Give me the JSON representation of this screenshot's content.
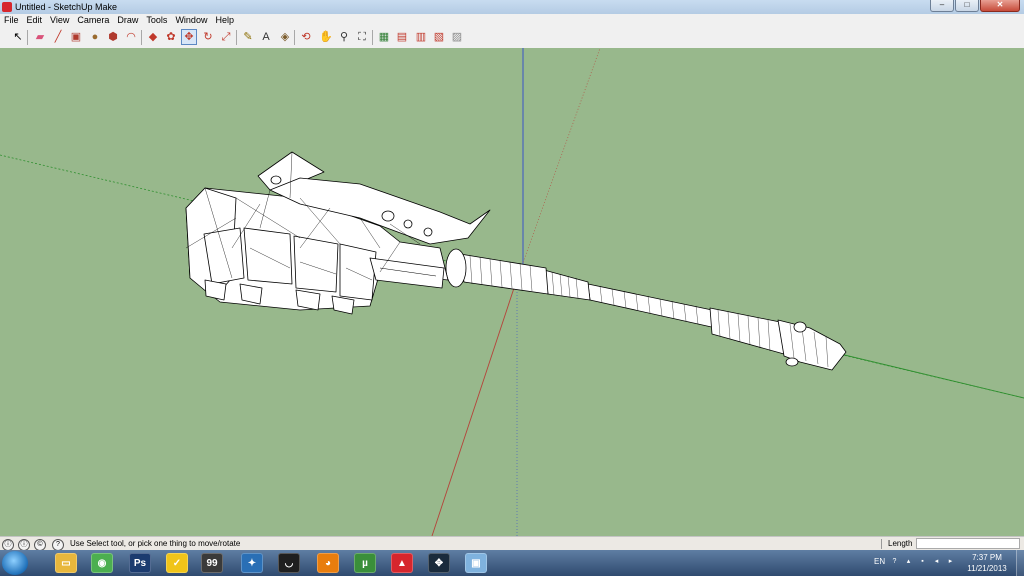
{
  "window": {
    "title": "Untitled - SketchUp Make",
    "minimize": "–",
    "maximize": "□",
    "close": "✕"
  },
  "menu": [
    "File",
    "Edit",
    "View",
    "Camera",
    "Draw",
    "Tools",
    "Window",
    "Help"
  ],
  "toolbar": {
    "tools": [
      {
        "name": "select-tool-icon",
        "glyph": "↖",
        "color": "#000000",
        "active": false
      },
      {
        "name": "eraser-tool-icon",
        "glyph": "▰",
        "color": "#d9537a",
        "active": false
      },
      {
        "name": "line-tool-icon",
        "glyph": "╱",
        "color": "#c0392b",
        "active": false
      },
      {
        "name": "rectangle-tool-icon",
        "glyph": "▣",
        "color": "#b03a2e",
        "active": false
      },
      {
        "name": "circle-tool-icon",
        "glyph": "●",
        "color": "#9a6b2f",
        "active": false
      },
      {
        "name": "polygon-tool-icon",
        "glyph": "⬢",
        "color": "#b03a2e",
        "active": false
      },
      {
        "name": "arc-tool-icon",
        "glyph": "◠",
        "color": "#c0392b",
        "active": false
      },
      {
        "name": "push-pull-tool-icon",
        "glyph": "◆",
        "color": "#c0392b",
        "active": false
      },
      {
        "name": "follow-me-tool-icon",
        "glyph": "✿",
        "color": "#c0392b",
        "active": false
      },
      {
        "name": "move-tool-icon",
        "glyph": "✥",
        "color": "#c0392b",
        "active": true
      },
      {
        "name": "rotate-tool-icon",
        "glyph": "↻",
        "color": "#c0392b",
        "active": false
      },
      {
        "name": "scale-tool-icon",
        "glyph": "⤢",
        "color": "#c0392b",
        "active": false
      },
      {
        "name": "tape-measure-tool-icon",
        "glyph": "✎",
        "color": "#8a6d00",
        "active": false
      },
      {
        "name": "text-tool-icon",
        "glyph": "A",
        "color": "#333333",
        "active": false
      },
      {
        "name": "paint-bucket-tool-icon",
        "glyph": "◈",
        "color": "#7a5a2a",
        "active": false
      },
      {
        "name": "orbit-tool-icon",
        "glyph": "⟲",
        "color": "#c0392b",
        "active": false
      },
      {
        "name": "pan-tool-icon",
        "glyph": "✋",
        "color": "#333333",
        "active": false
      },
      {
        "name": "zoom-tool-icon",
        "glyph": "⚲",
        "color": "#333333",
        "active": false
      },
      {
        "name": "zoom-extents-tool-icon",
        "glyph": "⛶",
        "color": "#333333",
        "active": false
      },
      {
        "name": "geo-location-icon",
        "glyph": "▦",
        "color": "#2e7d32",
        "active": false
      },
      {
        "name": "3d-warehouse-icon",
        "glyph": "▤",
        "color": "#c0392b",
        "active": false
      },
      {
        "name": "share-model-icon",
        "glyph": "▥",
        "color": "#c0392b",
        "active": false
      },
      {
        "name": "extension-warehouse-icon",
        "glyph": "▧",
        "color": "#c0392b",
        "active": false
      },
      {
        "name": "send-to-layout-icon",
        "glyph": "▨",
        "color": "#888888",
        "active": false
      }
    ]
  },
  "colors": {
    "sky_ground": "#98b88c",
    "axis_blue": "#3a53c8",
    "axis_red": "#b5433a",
    "axis_green": "#2f8f2f",
    "model_fill": "#ffffff"
  },
  "status": {
    "icons": [
      "ⓘ",
      "ⓘ",
      "©",
      "?"
    ],
    "hint": "Use Select tool, or pick one thing to move/rotate",
    "measurement_label": "Length",
    "measurement_value": ""
  },
  "taskbar": {
    "apps": [
      {
        "name": "file-explorer-icon",
        "glyph": "▭",
        "color": "#e8b73c"
      },
      {
        "name": "chrome-icon",
        "glyph": "◉",
        "color": "#4caf50"
      },
      {
        "name": "photoshop-icon",
        "glyph": "Ps",
        "color": "#1b3b6f"
      },
      {
        "name": "norton-icon",
        "glyph": "✓",
        "color": "#f0c419"
      },
      {
        "name": "winamp-icon",
        "glyph": "99",
        "color": "#3a3a3a"
      },
      {
        "name": "vector-app-icon",
        "glyph": "✦",
        "color": "#2a6fb5"
      },
      {
        "name": "headphones-app-icon",
        "glyph": "◡",
        "color": "#1f1f1f"
      },
      {
        "name": "blender-icon",
        "glyph": "◕",
        "color": "#e87d0d"
      },
      {
        "name": "utorrent-icon",
        "glyph": "µ",
        "color": "#3a8f3a"
      },
      {
        "name": "sketchup-icon",
        "glyph": "▲",
        "color": "#d6262d"
      },
      {
        "name": "network-app-icon",
        "glyph": "✥",
        "color": "#1a2b3c"
      },
      {
        "name": "remote-desktop-icon",
        "glyph": "▣",
        "color": "#7fb2de"
      }
    ],
    "tray": {
      "language": "EN",
      "help_icon": "?",
      "up_arrow": "▴",
      "clock_time": "7:37 PM",
      "clock_date": "11/21/2013"
    }
  }
}
